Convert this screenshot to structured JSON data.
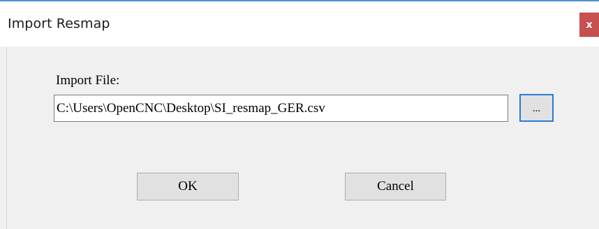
{
  "window": {
    "title": "Import Resmap",
    "close_glyph": "x"
  },
  "form": {
    "import_label": "Import File:",
    "file_path": "C:\\Users\\OpenCNC\\Desktop\\SI_resmap_GER.csv",
    "browse_label": "..."
  },
  "buttons": {
    "ok_label": "OK",
    "cancel_label": "Cancel"
  },
  "colors": {
    "title_accent": "#4a90d9",
    "close_bg": "#c75050",
    "focus_border": "#2a7ad6",
    "dialog_bg": "#f0f0f0"
  },
  "icons": {
    "close": "close-icon"
  }
}
